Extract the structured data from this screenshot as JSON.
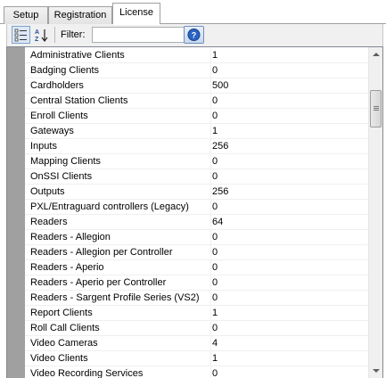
{
  "tabs": [
    {
      "label": "Setup"
    },
    {
      "label": "Registration"
    },
    {
      "label": "License"
    }
  ],
  "toolbar": {
    "filter_label": "Filter:",
    "filter_value": "",
    "icons": [
      "categorized-view-icon",
      "alphabetical-sort-icon",
      "help-icon"
    ]
  },
  "license_rows": [
    {
      "name": "Administrative Clients",
      "value": "1"
    },
    {
      "name": "Badging Clients",
      "value": "0"
    },
    {
      "name": "Cardholders",
      "value": "500"
    },
    {
      "name": "Central Station Clients",
      "value": "0"
    },
    {
      "name": "Enroll Clients",
      "value": "0"
    },
    {
      "name": "Gateways",
      "value": "1"
    },
    {
      "name": "Inputs",
      "value": "256"
    },
    {
      "name": "Mapping Clients",
      "value": "0"
    },
    {
      "name": "OnSSI Clients",
      "value": "0"
    },
    {
      "name": "Outputs",
      "value": "256"
    },
    {
      "name": "PXL/Entraguard controllers (Legacy)",
      "value": "0"
    },
    {
      "name": "Readers",
      "value": "64"
    },
    {
      "name": "Readers - Allegion",
      "value": "0"
    },
    {
      "name": "Readers - Allegion per Controller",
      "value": "0"
    },
    {
      "name": "Readers - Aperio",
      "value": "0"
    },
    {
      "name": "Readers - Aperio per Controller",
      "value": "0"
    },
    {
      "name": "Readers - Sargent Profile Series (VS2)",
      "value": "0"
    },
    {
      "name": "Report Clients",
      "value": "1"
    },
    {
      "name": "Roll Call Clients",
      "value": "0"
    },
    {
      "name": "Video Cameras",
      "value": "4"
    },
    {
      "name": "Video Clients",
      "value": "1"
    },
    {
      "name": "Video Recording Services",
      "value": "0"
    }
  ]
}
